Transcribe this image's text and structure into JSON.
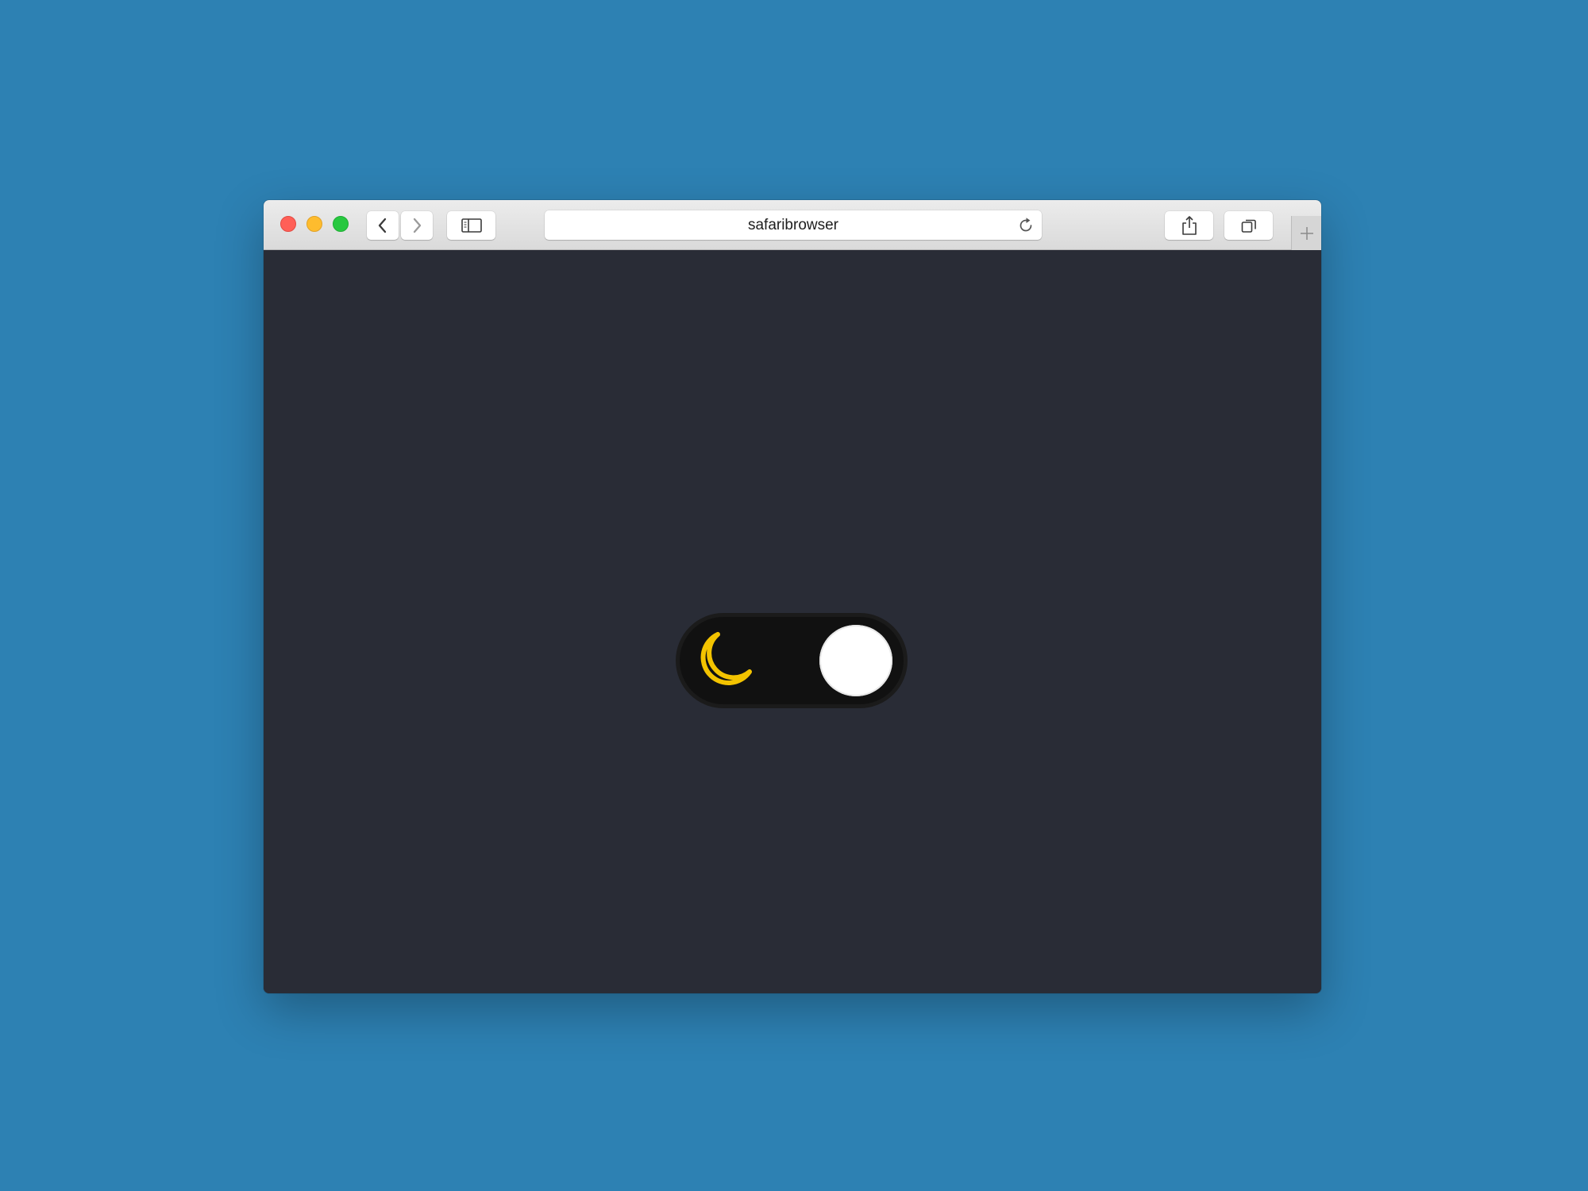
{
  "browser": {
    "address": "safaribrowser",
    "icons": {
      "close": "close-icon",
      "minimize": "minimize-icon",
      "zoom": "zoom-icon",
      "back": "chevron-left-icon",
      "forward": "chevron-right-icon",
      "sidebar": "sidebar-icon",
      "reload": "reload-icon",
      "share": "share-icon",
      "tabs": "tabs-icon",
      "new_tab": "plus-icon"
    },
    "colors": {
      "close": "#ff5f57",
      "minimize": "#febc2e",
      "zoom": "#28c840"
    }
  },
  "page": {
    "background": "#292c36",
    "theme_toggle": {
      "state": "dark",
      "icon": "moon-icon",
      "track_color": "#111111",
      "icon_color": "#f3c300",
      "knob_color": "#ffffff"
    }
  },
  "desktop": {
    "background": "#2d81b3"
  }
}
